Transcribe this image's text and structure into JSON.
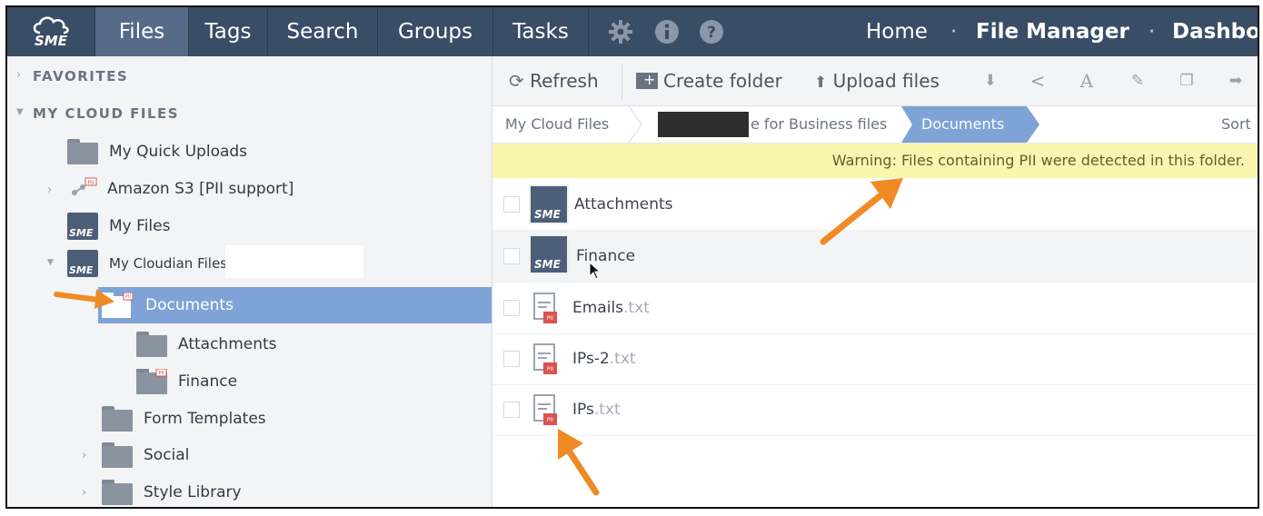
{
  "brand": {
    "logo_text": "SME"
  },
  "nav": {
    "tabs": [
      "Files",
      "Tags",
      "Search",
      "Groups",
      "Tasks"
    ],
    "active_tab": "Files",
    "right_links": {
      "home": "Home",
      "sep1": "·",
      "file_manager": "File Manager",
      "sep2": "·",
      "dashboard": "Dashbo"
    }
  },
  "sidebar": {
    "favorites": "FAVORITES",
    "my_cloud_files": "MY CLOUD FILES",
    "items": [
      {
        "label": "My Quick Uploads"
      },
      {
        "label": "Amazon S3 [PII support]"
      },
      {
        "label": "My Files"
      },
      {
        "label": "My Cloudian Files"
      },
      {
        "label": "Documents"
      },
      {
        "label": "Attachments"
      },
      {
        "label": "Finance"
      },
      {
        "label": "Form Templates"
      },
      {
        "label": "Social"
      },
      {
        "label": "Style Library"
      }
    ]
  },
  "toolbar": {
    "refresh": "Refresh",
    "create_folder": "Create folder",
    "upload_files": "Upload files"
  },
  "breadcrumb": {
    "root": "My Cloud Files",
    "middle": "e for Business files",
    "current": "Documents",
    "sort": "Sort"
  },
  "warning": "Warning: Files containing PII were detected in this folder.",
  "files": [
    {
      "name": "Attachments",
      "ext": "",
      "kind": "folder"
    },
    {
      "name": "Finance",
      "ext": "",
      "kind": "folder"
    },
    {
      "name": "Emails",
      "ext": ".txt",
      "kind": "file"
    },
    {
      "name": "IPs-2",
      "ext": ".txt",
      "kind": "file"
    },
    {
      "name": "IPs",
      "ext": ".txt",
      "kind": "file"
    }
  ],
  "colors": {
    "nav_bg": "#3a4d66",
    "selected": "#7fa3d6",
    "warning_bg": "#fbf6ae",
    "arrow": "#f08a24",
    "pii_badge": "#d9534f"
  }
}
